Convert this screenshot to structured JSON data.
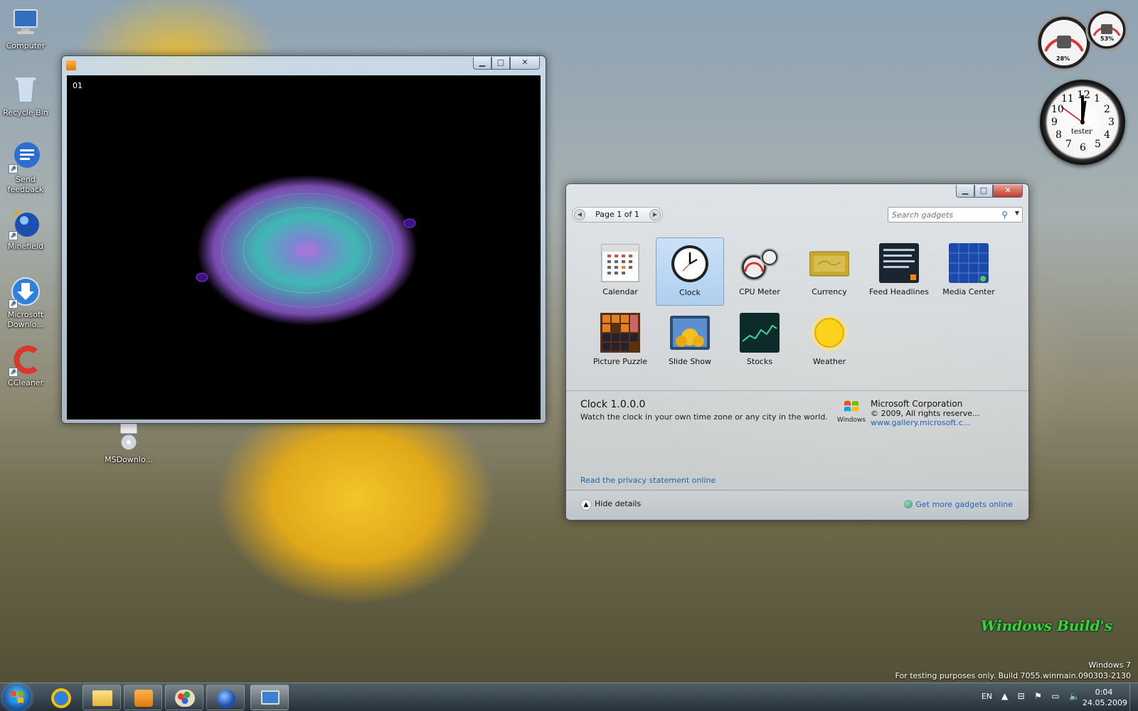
{
  "desktop": {
    "icons": [
      {
        "label": "Computer",
        "icon": "computer-icon"
      },
      {
        "label": "Recycle Bin",
        "icon": "recycle-bin-icon"
      },
      {
        "label": "Send feedback",
        "icon": "feedback-icon"
      },
      {
        "label": "Minefield",
        "icon": "minefield-icon"
      },
      {
        "label": "Microsoft Downlo...",
        "icon": "download-icon"
      },
      {
        "label": "CCleaner",
        "icon": "ccleaner-icon"
      },
      {
        "label": "MSDownlo...",
        "icon": "msdownload-icon"
      }
    ]
  },
  "player_window": {
    "counter": "01"
  },
  "gadgets_window": {
    "pager": "Page 1 of 1",
    "search_placeholder": "Search gadgets",
    "gadgets": [
      {
        "label": "Calendar"
      },
      {
        "label": "Clock",
        "selected": true
      },
      {
        "label": "CPU Meter"
      },
      {
        "label": "Currency"
      },
      {
        "label": "Feed Headlines"
      },
      {
        "label": "Media Center"
      },
      {
        "label": "Picture Puzzle"
      },
      {
        "label": "Slide Show"
      },
      {
        "label": "Stocks"
      },
      {
        "label": "Weather"
      }
    ],
    "details": {
      "name": "Clock 1.0.0.0",
      "description": "Watch the clock in your own time zone or any city in the world.",
      "publisher": "Microsoft Corporation",
      "copyright": "© 2009, All rights reserve...",
      "url": "www.gallery.microsoft.c...",
      "logo_text": "Windows"
    },
    "privacy_link": "Read the privacy statement online",
    "hide_details": "Hide details",
    "get_more": "Get more gadgets online"
  },
  "clock_gadget": {
    "label": "tester",
    "numbers": [
      "12",
      "1",
      "2",
      "3",
      "4",
      "5",
      "6",
      "7",
      "8",
      "9",
      "10",
      "11"
    ]
  },
  "cpu_gadget": {
    "cpu": "28%",
    "memory": "53%"
  },
  "watermark": {
    "line1": "Windows 7",
    "line2": "For testing purposes only. Build 7055.winmain.090303-2130",
    "logo": "Windows Build's"
  },
  "taskbar": {
    "language": "EN",
    "time": "0:04",
    "date": "24.05.2009"
  },
  "colors": {
    "accent": "#1e64b4",
    "selected_tile": "#b4d2f0",
    "close_button": "#c0392b"
  }
}
